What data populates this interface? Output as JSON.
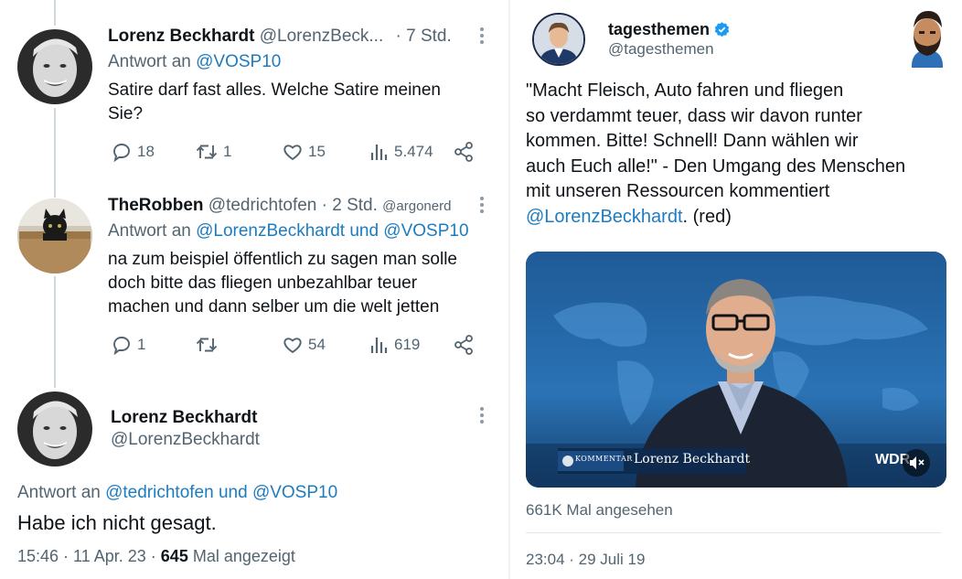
{
  "left": {
    "tweet1": {
      "name": "Lorenz Beckhardt",
      "handle": "@LorenzBeck...",
      "time": "· 7 Std.",
      "reply_prefix": "Antwort an",
      "reply_to": "@VOSP10",
      "text_line1": "Satire darf fast alles. Welche Satire meinen",
      "text_line2": "Sie?",
      "replies": "18",
      "retweets": "1",
      "likes": "15",
      "views": "5.474"
    },
    "tweet2": {
      "name": "TheRobben",
      "handle": "@tedrichtofen",
      "time": "· 2 Std.",
      "watermark": "@argonerd",
      "reply_prefix": "Antwort an",
      "reply_to": "@LorenzBeckhardt und @VOSP10",
      "text_line1": "na zum beispiel öffentlich zu sagen man solle",
      "text_line2": "doch bitte das fliegen unbezahlbar teuer",
      "text_line3": "machen und dann selber um die welt jetten",
      "replies": "1",
      "retweets": "",
      "likes": "54",
      "views": "619"
    },
    "tweet3": {
      "name": "Lorenz Beckhardt",
      "handle": "@LorenzBeckhardt",
      "reply_prefix": "Antwort an",
      "reply_to": "@tedrichtofen und @VOSP10",
      "text": "Habe ich nicht gesagt.",
      "timestamp": "15:46 · 11 Apr. 23 ·",
      "views_count": "645",
      "views_label": "Mal angezeigt"
    }
  },
  "right": {
    "name": "tagesthemen",
    "handle": "@tagesthemen",
    "text_line1": "\"Macht Fleisch, Auto fahren und fliegen",
    "text_line2": "so verdammt teuer, dass wir davon runter",
    "text_line3": "kommen. Bitte! Schnell! Dann wählen wir",
    "text_line4": "auch Euch alle!\" - Den Umgang des Menschen",
    "text_line5": "mit unseren Ressourcen kommentiert",
    "mention": "@LorenzBeckhardt",
    "text_suffix": ". (red)",
    "video_tag": "KOMMENTAR",
    "video_name": "Lorenz Beckhardt",
    "video_logo": "WDR",
    "views": "661K Mal angesehen",
    "timestamp": "23:04 · 29 Juli 19"
  },
  "colors": {
    "link": "#1d7bbf",
    "secondary": "#536471",
    "verified": "#1d9bf0"
  },
  "icons": [
    "reply-icon",
    "retweet-icon",
    "like-icon",
    "views-icon",
    "share-icon",
    "more-icon",
    "verified-icon",
    "mute-icon"
  ]
}
